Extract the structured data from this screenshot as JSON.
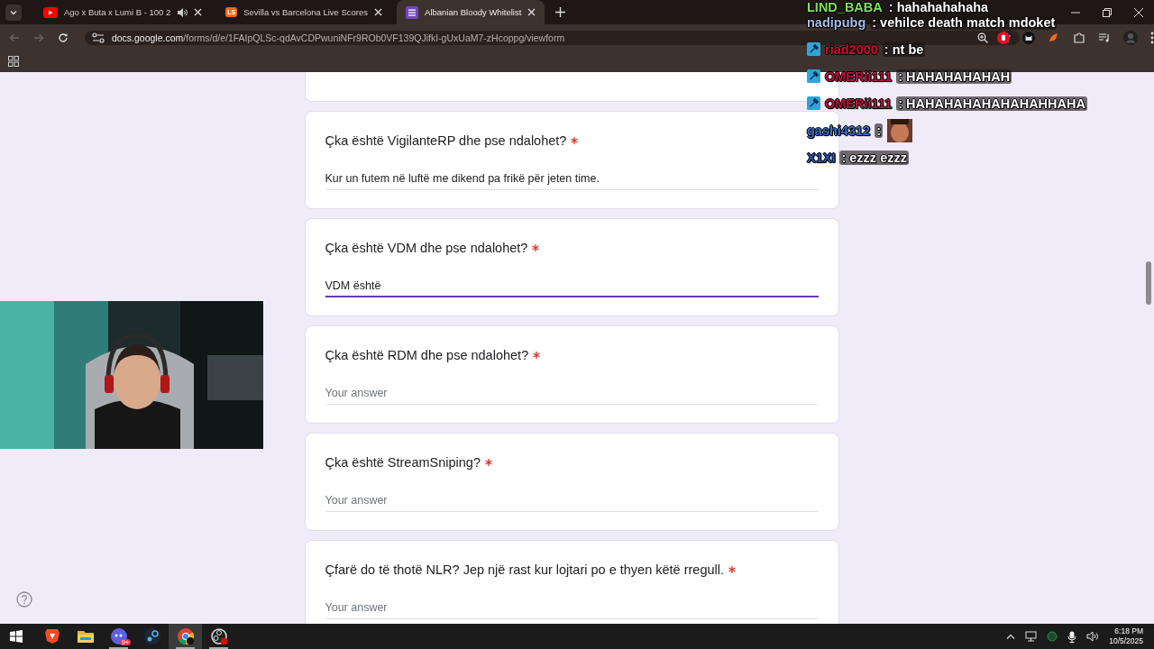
{
  "browser": {
    "tabs": [
      {
        "title": "Ago x Buta x Lumi B - 100 2",
        "kind": "video",
        "audio": true,
        "selected": false
      },
      {
        "title": "Sevilla vs Barcelona Live Scores",
        "kind": "letters",
        "icon_text": "LS",
        "audio": false,
        "selected": false
      },
      {
        "title": "Albanian Bloody Whitelist",
        "kind": "form",
        "audio": false,
        "selected": true
      }
    ],
    "address": {
      "host": "docs.google.com",
      "path": "/forms/d/e/1FAIpQLSc-qdAvCDPwuniNFr9ROb0VF139QJifkI-gUxUaM7-zHcoppg/viewform"
    }
  },
  "form": {
    "questions": [
      {
        "title": "Çka është VigilanteRP dhe pse ndalohet?",
        "required": true,
        "value": "Kur un futem në luftë me dikend pa frikë për jeten time.",
        "focused": false
      },
      {
        "title": "Çka është VDM dhe pse ndalohet?",
        "required": true,
        "value": "VDM është",
        "focused": true
      },
      {
        "title": "Çka është RDM dhe pse ndalohet?",
        "required": true,
        "placeholder": "Your answer",
        "focused": false
      },
      {
        "title": "Çka është StreamSniping?",
        "required": true,
        "placeholder": "Your answer",
        "focused": false
      },
      {
        "title": "Çfarë do të thotë NLR? Jep një rast kur lojtari po e thyen këtë rregull.",
        "required": true,
        "placeholder": "Your answer",
        "focused": false
      }
    ]
  },
  "chat": [
    {
      "kind": "text",
      "user": "LIND_BABA",
      "color": "#7fe35c",
      "moderator": false,
      "message": ": hahahahahaha"
    },
    {
      "kind": "text",
      "user": "nadipubg",
      "color": "#a9bde6",
      "moderator": false,
      "message": ": vehilce death match mdoket"
    },
    {
      "kind": "text",
      "user": "riad2000",
      "color": "#d0102c",
      "moderator": true,
      "message": ": nt be"
    },
    {
      "kind": "text",
      "user": "OMERii111",
      "color": "#b8143c",
      "moderator": true,
      "message": ": HAHAHAHAHAH"
    },
    {
      "kind": "text",
      "user": "OMERii111",
      "color": "#b8143c",
      "moderator": true,
      "message": ": HAHAHAHAHAHAHAHHAHA"
    },
    {
      "kind": "emote",
      "user": "gashi4312",
      "color": "#3d6fc4",
      "moderator": false,
      "message": ":"
    },
    {
      "kind": "text",
      "user": "X1XI",
      "color": "#2c52b4",
      "moderator": false,
      "message": ": ezzz ezzz"
    }
  ],
  "taskbar": {
    "apps": [
      {
        "kind": "brave",
        "running": false,
        "active": false
      },
      {
        "kind": "folder",
        "running": false,
        "active": false
      },
      {
        "kind": "chat",
        "badge": "9+",
        "running": true,
        "active": false
      },
      {
        "kind": "steam",
        "running": false,
        "active": false
      },
      {
        "kind": "chrome",
        "running": true,
        "active": true
      },
      {
        "kind": "recorder",
        "running": true,
        "active": false
      }
    ],
    "clock": {
      "time": "6:18 PM",
      "date": "10/5/2025"
    }
  }
}
